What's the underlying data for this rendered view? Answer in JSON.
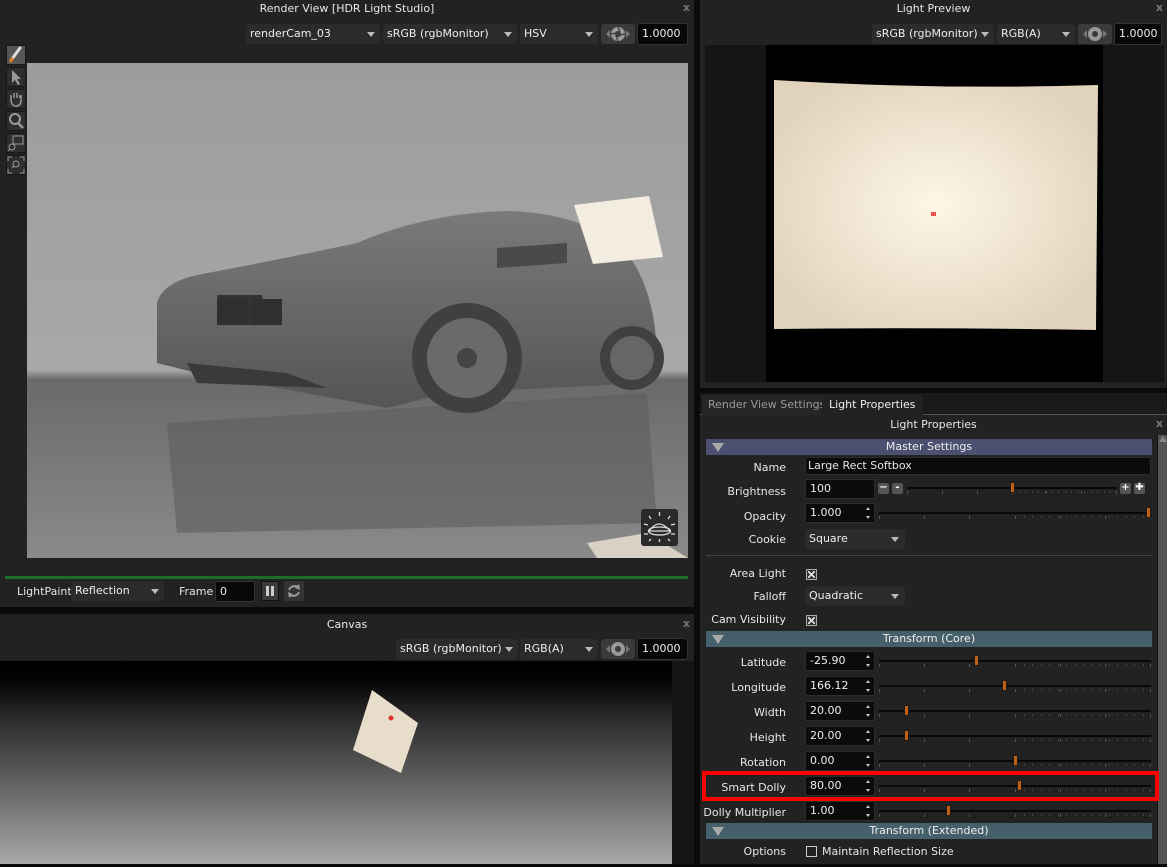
{
  "render_view": {
    "title": "Render View [HDR Light Studio]",
    "close": "x",
    "camera": "renderCam_03",
    "colorspace": "sRGB (rgbMonitor)",
    "channel": "HSV",
    "exposure": "1.0000",
    "tools": [
      "brush-icon",
      "pointer-icon",
      "hand-icon",
      "zoom-icon",
      "zoom-region-icon",
      "zoom-fit-icon"
    ],
    "lightpaint_label": "LightPaint",
    "lightpaint_mode": "Reflection",
    "frame_label": "Frame",
    "frame_value": "0"
  },
  "canvas": {
    "title": "Canvas",
    "close": "x",
    "colorspace": "sRGB (rgbMonitor)",
    "channel": "RGB(A)",
    "exposure": "1.0000"
  },
  "light_preview": {
    "title": "Light Preview",
    "close": "x",
    "colorspace": "sRGB (rgbMonitor)",
    "channel": "RGB(A)",
    "exposure": "1.0000"
  },
  "tabs": [
    {
      "label": "Render View Settings",
      "active": false
    },
    {
      "label": "Light Properties",
      "active": true
    }
  ],
  "light_properties": {
    "title": "Light Properties",
    "close": "x",
    "sections": {
      "master": "Master Settings",
      "core": "Transform (Core)",
      "extended": "Transform (Extended)"
    },
    "name_label": "Name",
    "name_value": "Large Rect Softbox",
    "brightness_label": "Brightness",
    "brightness_value": "100",
    "brightness_position": 0.5,
    "opacity_label": "Opacity",
    "opacity_value": "1.000",
    "opacity_position": 1.0,
    "cookie_label": "Cookie",
    "cookie_value": "Square",
    "area_light_label": "Area Light",
    "area_light_checked": true,
    "falloff_label": "Falloff",
    "falloff_value": "Quadratic",
    "cam_visibility_label": "Cam Visibility",
    "cam_visibility_checked": true,
    "transform": [
      {
        "label": "Latitude",
        "value": "-25.90",
        "position": 0.355
      },
      {
        "label": "Longitude",
        "value": "166.12",
        "position": 0.46
      },
      {
        "label": "Width",
        "value": "20.00",
        "position": 0.095
      },
      {
        "label": "Height",
        "value": "20.00",
        "position": 0.095
      },
      {
        "label": "Rotation",
        "value": "0.00",
        "position": 0.5
      },
      {
        "label": "Smart Dolly",
        "value": "80.00",
        "position": 0.515,
        "highlighted": true
      },
      {
        "label": "Dolly Multiplier",
        "value": "1.00",
        "position": 0.25
      }
    ],
    "options_label": "Options",
    "maintain_reflection_label": "Maintain Reflection Size",
    "maintain_reflection_checked": false
  },
  "colors": {
    "accent_handle": "#c06010",
    "highlight_box": "#ff0000",
    "master_section": "#4b5070",
    "transform_section": "#45606a",
    "progress_bar": "#1f6b2a"
  }
}
